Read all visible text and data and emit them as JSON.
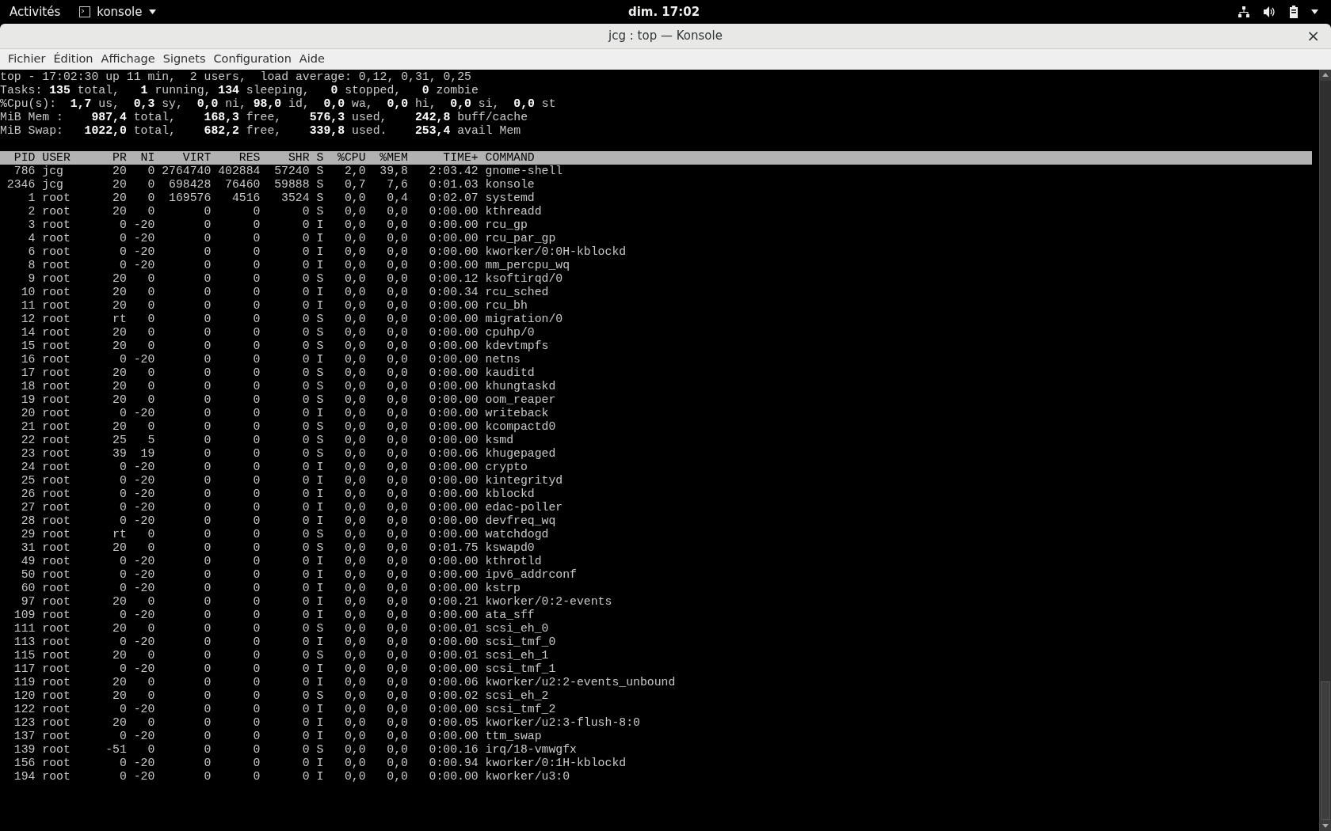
{
  "top_bar": {
    "activities": "Activités",
    "app_menu": "konsole",
    "clock": "dim. 17:02"
  },
  "window": {
    "title": "jcg : top — Konsole",
    "close": "×"
  },
  "menu": [
    "Fichier",
    "Édition",
    "Affichage",
    "Signets",
    "Configuration",
    "Aide"
  ],
  "summary": [
    "top - 17:02:30 up 11 min,  2 users,  load average: 0,12, 0,31, 0,25",
    "Tasks: **135** total,   **1** running, **134** sleeping,   **0** stopped,   **0** zombie",
    "%Cpu(s):  **1,7** us,  **0,3** sy,  **0,0** ni, **98,0** id,  **0,0** wa,  **0,0** hi,  **0,0** si,  **0,0** st",
    "MiB Mem :    **987,4** total,    **168,3** free,    **576,3** used,    **242,8** buff/cache",
    "MiB Swap:   **1022,0** total,    **682,2** free,    **339,8** used.    **253,4** avail Mem"
  ],
  "table": {
    "columns": [
      "PID",
      "USER",
      "PR",
      "NI",
      "VIRT",
      "RES",
      "SHR",
      "S",
      "%CPU",
      "%MEM",
      "TIME+",
      "COMMAND"
    ],
    "rows": [
      [
        "786",
        "jcg",
        "20",
        "0",
        "2764740",
        "402884",
        "57240",
        "S",
        "2,0",
        "39,8",
        "2:03.42",
        "gnome-shell"
      ],
      [
        "2346",
        "jcg",
        "20",
        "0",
        "698428",
        "76460",
        "59888",
        "S",
        "0,7",
        "7,6",
        "0:01.03",
        "konsole"
      ],
      [
        "1",
        "root",
        "20",
        "0",
        "169576",
        "4516",
        "3524",
        "S",
        "0,0",
        "0,4",
        "0:02.07",
        "systemd"
      ],
      [
        "2",
        "root",
        "20",
        "0",
        "0",
        "0",
        "0",
        "S",
        "0,0",
        "0,0",
        "0:00.00",
        "kthreadd"
      ],
      [
        "3",
        "root",
        "0",
        "-20",
        "0",
        "0",
        "0",
        "I",
        "0,0",
        "0,0",
        "0:00.00",
        "rcu_gp"
      ],
      [
        "4",
        "root",
        "0",
        "-20",
        "0",
        "0",
        "0",
        "I",
        "0,0",
        "0,0",
        "0:00.00",
        "rcu_par_gp"
      ],
      [
        "6",
        "root",
        "0",
        "-20",
        "0",
        "0",
        "0",
        "I",
        "0,0",
        "0,0",
        "0:00.00",
        "kworker/0:0H-kblockd"
      ],
      [
        "8",
        "root",
        "0",
        "-20",
        "0",
        "0",
        "0",
        "I",
        "0,0",
        "0,0",
        "0:00.00",
        "mm_percpu_wq"
      ],
      [
        "9",
        "root",
        "20",
        "0",
        "0",
        "0",
        "0",
        "S",
        "0,0",
        "0,0",
        "0:00.12",
        "ksoftirqd/0"
      ],
      [
        "10",
        "root",
        "20",
        "0",
        "0",
        "0",
        "0",
        "I",
        "0,0",
        "0,0",
        "0:00.34",
        "rcu_sched"
      ],
      [
        "11",
        "root",
        "20",
        "0",
        "0",
        "0",
        "0",
        "I",
        "0,0",
        "0,0",
        "0:00.00",
        "rcu_bh"
      ],
      [
        "12",
        "root",
        "rt",
        "0",
        "0",
        "0",
        "0",
        "S",
        "0,0",
        "0,0",
        "0:00.00",
        "migration/0"
      ],
      [
        "14",
        "root",
        "20",
        "0",
        "0",
        "0",
        "0",
        "S",
        "0,0",
        "0,0",
        "0:00.00",
        "cpuhp/0"
      ],
      [
        "15",
        "root",
        "20",
        "0",
        "0",
        "0",
        "0",
        "S",
        "0,0",
        "0,0",
        "0:00.00",
        "kdevtmpfs"
      ],
      [
        "16",
        "root",
        "0",
        "-20",
        "0",
        "0",
        "0",
        "I",
        "0,0",
        "0,0",
        "0:00.00",
        "netns"
      ],
      [
        "17",
        "root",
        "20",
        "0",
        "0",
        "0",
        "0",
        "S",
        "0,0",
        "0,0",
        "0:00.00",
        "kauditd"
      ],
      [
        "18",
        "root",
        "20",
        "0",
        "0",
        "0",
        "0",
        "S",
        "0,0",
        "0,0",
        "0:00.00",
        "khungtaskd"
      ],
      [
        "19",
        "root",
        "20",
        "0",
        "0",
        "0",
        "0",
        "S",
        "0,0",
        "0,0",
        "0:00.00",
        "oom_reaper"
      ],
      [
        "20",
        "root",
        "0",
        "-20",
        "0",
        "0",
        "0",
        "I",
        "0,0",
        "0,0",
        "0:00.00",
        "writeback"
      ],
      [
        "21",
        "root",
        "20",
        "0",
        "0",
        "0",
        "0",
        "S",
        "0,0",
        "0,0",
        "0:00.00",
        "kcompactd0"
      ],
      [
        "22",
        "root",
        "25",
        "5",
        "0",
        "0",
        "0",
        "S",
        "0,0",
        "0,0",
        "0:00.00",
        "ksmd"
      ],
      [
        "23",
        "root",
        "39",
        "19",
        "0",
        "0",
        "0",
        "S",
        "0,0",
        "0,0",
        "0:00.06",
        "khugepaged"
      ],
      [
        "24",
        "root",
        "0",
        "-20",
        "0",
        "0",
        "0",
        "I",
        "0,0",
        "0,0",
        "0:00.00",
        "crypto"
      ],
      [
        "25",
        "root",
        "0",
        "-20",
        "0",
        "0",
        "0",
        "I",
        "0,0",
        "0,0",
        "0:00.00",
        "kintegrityd"
      ],
      [
        "26",
        "root",
        "0",
        "-20",
        "0",
        "0",
        "0",
        "I",
        "0,0",
        "0,0",
        "0:00.00",
        "kblockd"
      ],
      [
        "27",
        "root",
        "0",
        "-20",
        "0",
        "0",
        "0",
        "I",
        "0,0",
        "0,0",
        "0:00.00",
        "edac-poller"
      ],
      [
        "28",
        "root",
        "0",
        "-20",
        "0",
        "0",
        "0",
        "I",
        "0,0",
        "0,0",
        "0:00.00",
        "devfreq_wq"
      ],
      [
        "29",
        "root",
        "rt",
        "0",
        "0",
        "0",
        "0",
        "S",
        "0,0",
        "0,0",
        "0:00.00",
        "watchdogd"
      ],
      [
        "31",
        "root",
        "20",
        "0",
        "0",
        "0",
        "0",
        "S",
        "0,0",
        "0,0",
        "0:01.75",
        "kswapd0"
      ],
      [
        "49",
        "root",
        "0",
        "-20",
        "0",
        "0",
        "0",
        "I",
        "0,0",
        "0,0",
        "0:00.00",
        "kthrotld"
      ],
      [
        "50",
        "root",
        "0",
        "-20",
        "0",
        "0",
        "0",
        "I",
        "0,0",
        "0,0",
        "0:00.00",
        "ipv6_addrconf"
      ],
      [
        "60",
        "root",
        "0",
        "-20",
        "0",
        "0",
        "0",
        "I",
        "0,0",
        "0,0",
        "0:00.00",
        "kstrp"
      ],
      [
        "97",
        "root",
        "20",
        "0",
        "0",
        "0",
        "0",
        "I",
        "0,0",
        "0,0",
        "0:00.21",
        "kworker/0:2-events"
      ],
      [
        "109",
        "root",
        "0",
        "-20",
        "0",
        "0",
        "0",
        "I",
        "0,0",
        "0,0",
        "0:00.00",
        "ata_sff"
      ],
      [
        "111",
        "root",
        "20",
        "0",
        "0",
        "0",
        "0",
        "S",
        "0,0",
        "0,0",
        "0:00.01",
        "scsi_eh_0"
      ],
      [
        "113",
        "root",
        "0",
        "-20",
        "0",
        "0",
        "0",
        "I",
        "0,0",
        "0,0",
        "0:00.00",
        "scsi_tmf_0"
      ],
      [
        "115",
        "root",
        "20",
        "0",
        "0",
        "0",
        "0",
        "S",
        "0,0",
        "0,0",
        "0:00.01",
        "scsi_eh_1"
      ],
      [
        "117",
        "root",
        "0",
        "-20",
        "0",
        "0",
        "0",
        "I",
        "0,0",
        "0,0",
        "0:00.00",
        "scsi_tmf_1"
      ],
      [
        "119",
        "root",
        "20",
        "0",
        "0",
        "0",
        "0",
        "I",
        "0,0",
        "0,0",
        "0:00.06",
        "kworker/u2:2-events_unbound"
      ],
      [
        "120",
        "root",
        "20",
        "0",
        "0",
        "0",
        "0",
        "S",
        "0,0",
        "0,0",
        "0:00.02",
        "scsi_eh_2"
      ],
      [
        "122",
        "root",
        "0",
        "-20",
        "0",
        "0",
        "0",
        "I",
        "0,0",
        "0,0",
        "0:00.00",
        "scsi_tmf_2"
      ],
      [
        "123",
        "root",
        "20",
        "0",
        "0",
        "0",
        "0",
        "I",
        "0,0",
        "0,0",
        "0:00.05",
        "kworker/u2:3-flush-8:0"
      ],
      [
        "137",
        "root",
        "0",
        "-20",
        "0",
        "0",
        "0",
        "I",
        "0,0",
        "0,0",
        "0:00.00",
        "ttm_swap"
      ],
      [
        "139",
        "root",
        "-51",
        "0",
        "0",
        "0",
        "0",
        "S",
        "0,0",
        "0,0",
        "0:00.16",
        "irq/18-vmwgfx"
      ],
      [
        "156",
        "root",
        "0",
        "-20",
        "0",
        "0",
        "0",
        "I",
        "0,0",
        "0,0",
        "0:00.94",
        "kworker/0:1H-kblockd"
      ],
      [
        "194",
        "root",
        "0",
        "-20",
        "0",
        "0",
        "0",
        "I",
        "0,0",
        "0,0",
        "0:00.00",
        "kworker/u3:0"
      ]
    ]
  }
}
